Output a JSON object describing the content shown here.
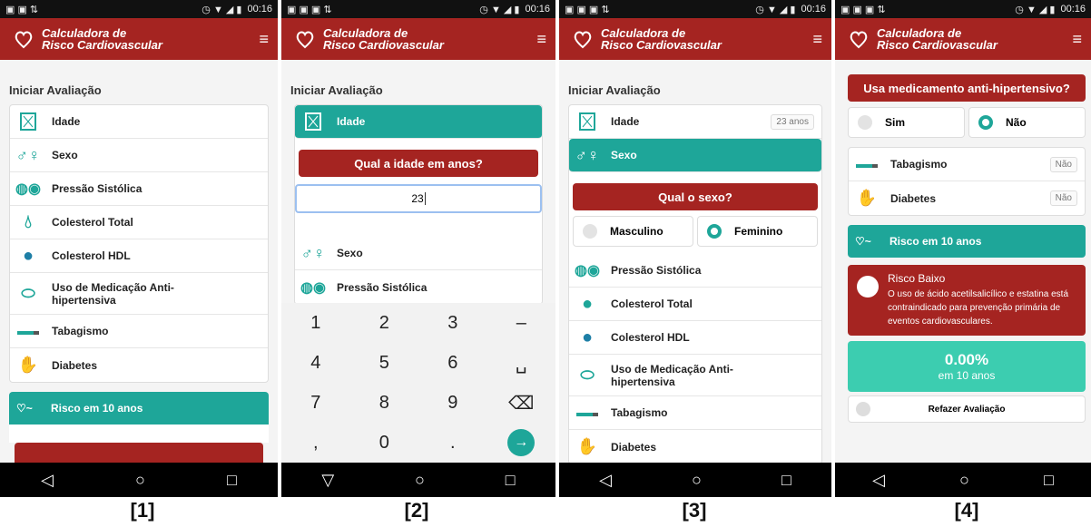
{
  "app": {
    "title_line1": "Calculadora de",
    "title_line2": "Risco Cardiovascular",
    "menu_icon": "hamburger-icon",
    "accent": "#a52421",
    "teal": "#1ea699"
  },
  "status": {
    "time": "00:16"
  },
  "section_title": "Iniciar Avaliação",
  "screen1": {
    "items": [
      "Idade",
      "Sexo",
      "Pressão Sistólica",
      "Colesterol Total",
      "Colesterol HDL",
      "Uso de Medicação Anti-hipertensiva",
      "Tabagismo",
      "Diabetes"
    ],
    "risk": "Risco em 10 anos"
  },
  "screen2": {
    "active": "Idade",
    "question": "Qual a idade em anos?",
    "input_value": "23",
    "items": [
      "Sexo",
      "Pressão Sistólica"
    ],
    "keys": [
      "1",
      "2",
      "3",
      "–",
      "4",
      "5",
      "6",
      "␣",
      "7",
      "8",
      "9",
      "⌫",
      ",",
      "0",
      ".",
      "→"
    ]
  },
  "screen3": {
    "idade": "Idade",
    "idade_badge": "23 anos",
    "active": "Sexo",
    "question": "Qual o sexo?",
    "opt1": "Masculino",
    "opt2": "Feminino",
    "items": [
      "Pressão Sistólica",
      "Colesterol Total",
      "Colesterol HDL",
      "Uso de Medicação Anti-hipertensiva",
      "Tabagismo",
      "Diabetes"
    ]
  },
  "screen4": {
    "question": "Usa medicamento anti-hipertensivo?",
    "opt1": "Sim",
    "opt2": "Não",
    "tab": "Tabagismo",
    "tab_badge": "Não",
    "dia": "Diabetes",
    "dia_badge": "Não",
    "risk": "Risco em 10 anos",
    "risk_level": "Risco Baixo",
    "risk_text": "O uso de ácido acetilsalicílico e estatina está contraindicado para prevenção primária de eventos cardiovasculares.",
    "pct": "0.00%",
    "pct_sub": "em 10 anos",
    "redo": "Refazer Avaliação"
  },
  "captions": [
    "[1]",
    "[2]",
    "[3]",
    "[4]"
  ]
}
